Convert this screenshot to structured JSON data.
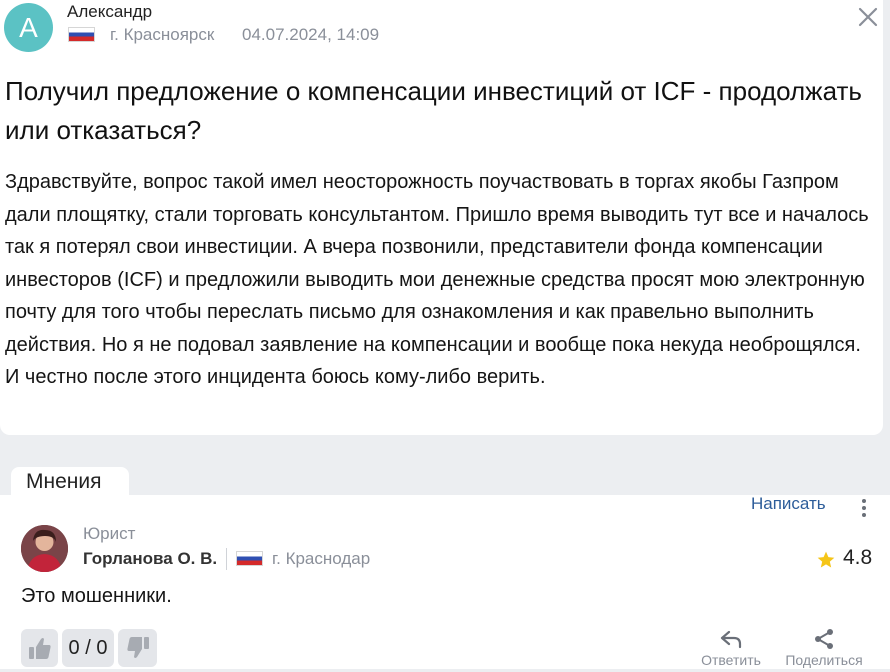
{
  "post": {
    "avatar_letter": "А",
    "author": "Александр",
    "city": "г. Красноярск",
    "datetime": "04.07.2024, 14:09",
    "title": "Получил предложение о компенсации инвестиций от ICF - продолжать или отказаться?",
    "body": "Здравствуйте, вопрос такой имел неосторожность поучаствовать в торгах якобы Газпром дали площятку, стали торговать консультантом. Пришло время выводить тут все и началось так я потерял свои инвестиции. А вчера позвонили, представители фонда компенсации инвесторов (ICF) и предложили выводить мои денежные средства просят мою электронную почту для того чтобы переслать письмо для ознакомления и как правельно выполнить действия. Но я не подовал заявление на компенсации и вообще пока некуда необрощялся. И честно после этого инцидента боюсь кому-либо верить."
  },
  "opinions": {
    "tab_label": "Мнения",
    "write_label": "Написать",
    "answer": {
      "role": "Юрист",
      "name": "Горланова О. В.",
      "city": "г. Краснодар",
      "rating": "4.8",
      "text": "Это мошенники.",
      "votes": "0 / 0",
      "reply_label": "Ответить",
      "share_label": "Поделиться"
    }
  },
  "colors": {
    "avatar_bg": "#5bc2c4",
    "link": "#2d5d9a",
    "star": "#f5c518",
    "page_bg": "#eceef1"
  },
  "icons": [
    "close-icon",
    "russia-flag-icon",
    "more-vertical-icon",
    "star-icon",
    "thumbs-up-icon",
    "thumbs-down-icon",
    "reply-icon",
    "share-icon"
  ]
}
